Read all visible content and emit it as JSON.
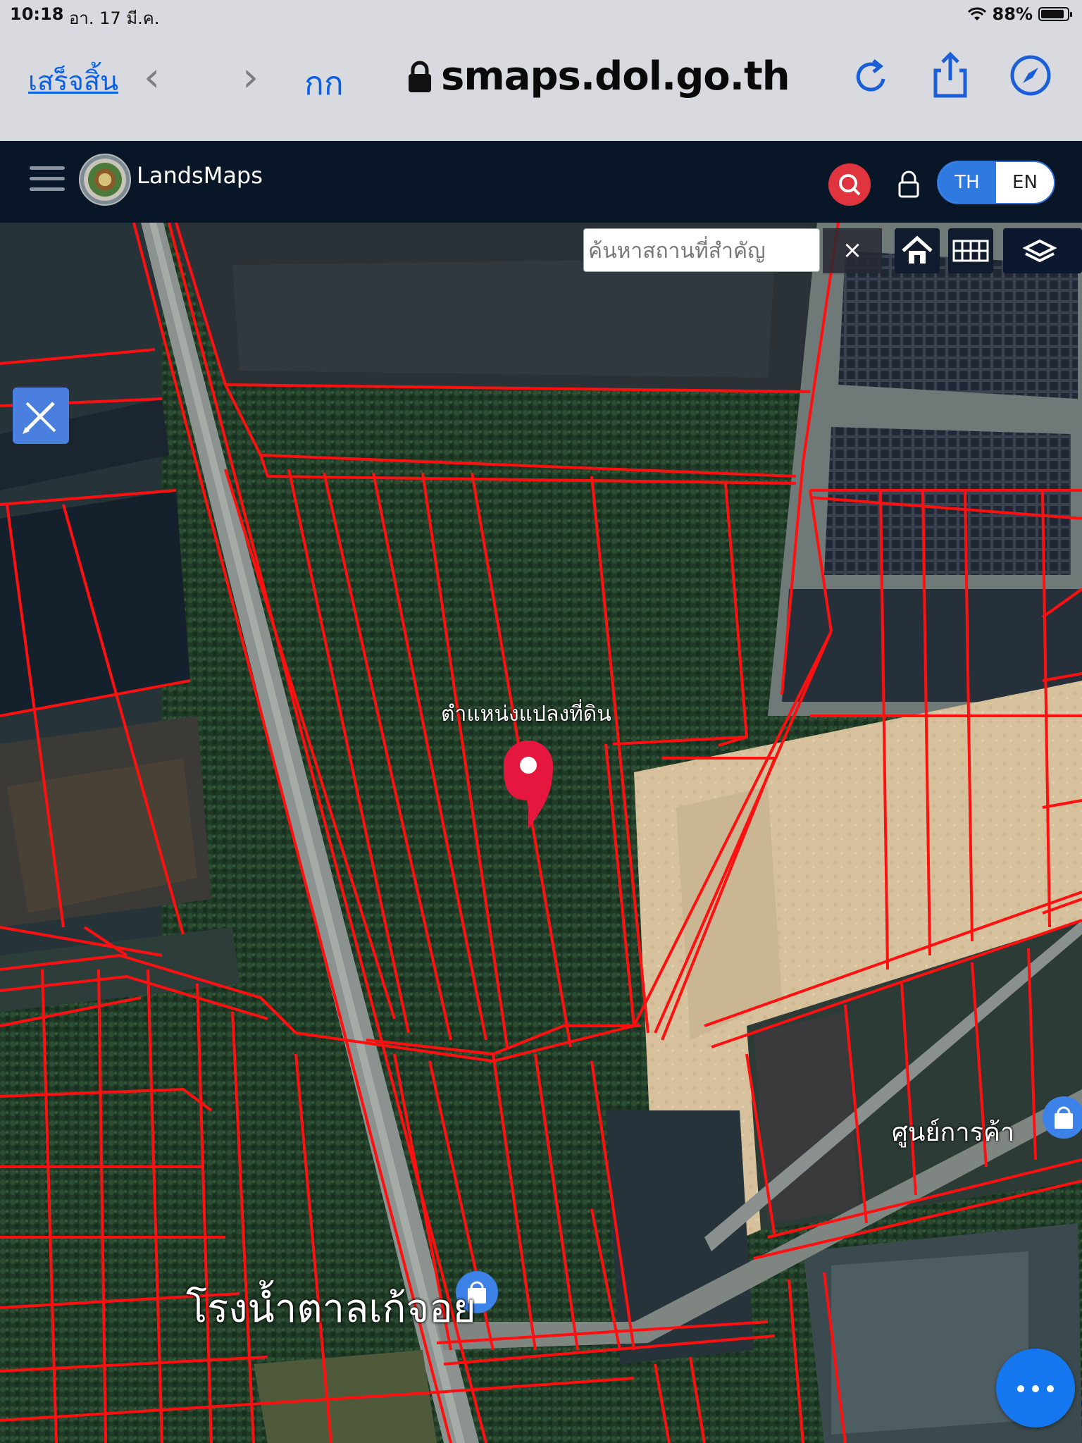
{
  "status_bar": {
    "time": "10:18",
    "date": "อา. 17 มี.ค.",
    "battery": "88%",
    "battery_level": 0.88,
    "icons": [
      "wifi-icon",
      "battery-icon"
    ]
  },
  "browser": {
    "done_label": "เสร็จสิ้น",
    "text_size_label": "กก",
    "url": "smaps.dol.go.th",
    "icons": [
      "back-icon",
      "forward-icon",
      "lock-icon",
      "reload-icon",
      "share-icon",
      "compass-icon"
    ]
  },
  "app": {
    "title": "LandsMaps",
    "lang_th": "TH",
    "lang_en": "EN",
    "selected_lang": "TH",
    "accent_color": "#e0353f",
    "header_color": "#091628"
  },
  "map": {
    "search_placeholder": "ค้นหาสถานที่สำคัญ",
    "clear_label": "×",
    "pin_label": "ตำแหน่งแปลงที่ดิน",
    "pin_color": "#e5173f",
    "parcel_line_color": "#ff1010",
    "poi_labels": {
      "mall": "ศูนย์การค้า",
      "sugar_factory": "โรงน้ำตาลเก้จอย"
    },
    "tool_icons": [
      "home-icon",
      "grid-icon",
      "layers-icon",
      "edit-icon"
    ]
  },
  "more_button_label": "more options"
}
